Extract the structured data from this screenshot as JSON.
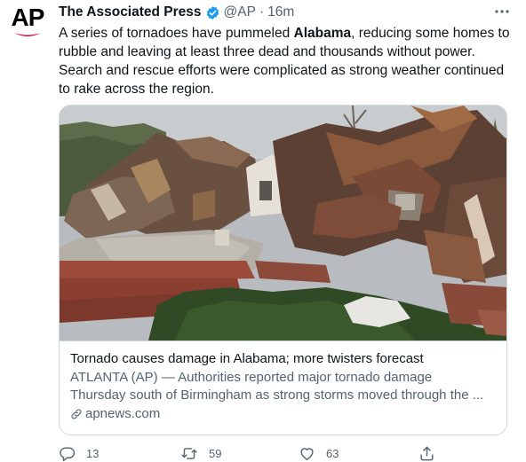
{
  "author": {
    "name": "The Associated Press",
    "handle": "@AP",
    "separator": "·",
    "time": "16m",
    "avatar_text": "AP"
  },
  "tweet": {
    "text_before": "A series of tornadoes have pummeled ",
    "text_bold": "Alabama",
    "text_after": ", reducing some homes to rubble and leaving at least three dead and thousands without power. Search and rescue efforts were complicated as strong weather continued to rake across the region."
  },
  "card": {
    "title": "Tornado causes damage in Alabama; more twisters forecast",
    "description_line1": "ATLANTA (AP) — Authorities reported major tornado damage",
    "description_line2": "Thursday south of Birmingham as strong storms moved through the ...",
    "link": "apnews.com"
  },
  "actions": {
    "replies": "13",
    "retweets": "59",
    "likes": "63"
  },
  "icons": {
    "verified": "verified-badge-icon",
    "more": "more-icon",
    "link": "link-icon",
    "reply": "reply-icon",
    "retweet": "retweet-icon",
    "like": "heart-icon",
    "share": "share-icon"
  },
  "colors": {
    "verified": "#1d9bf0",
    "text": "#0f1419",
    "secondary": "#536471",
    "ap_red": "#e4002b"
  }
}
